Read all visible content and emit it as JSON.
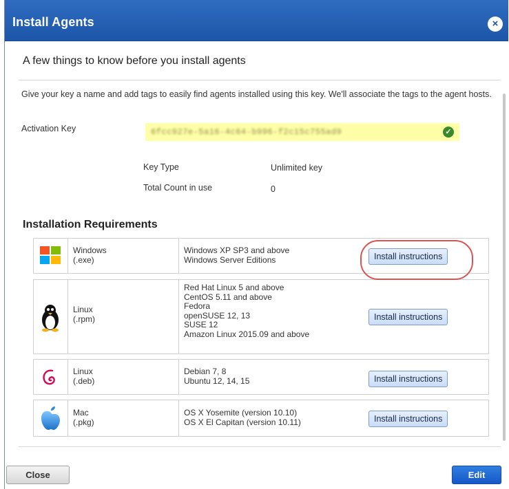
{
  "dialog": {
    "title": "Install Agents",
    "close_icon": "×",
    "subtitle": "A few things to know before you install agents",
    "intro": "Give your key a name and add tags to easily find agents installed using this key. We'll associate the tags to the agent hosts.",
    "activation_key_label": "Activation Key",
    "activation_key_value": "6fcc927e-5a16-4c64-b996-f2c15c755ad9",
    "key_type_label": "Key Type",
    "key_type_value": "Unlimited key",
    "total_count_label": "Total Count in use",
    "total_count_value": "0",
    "requirements_heading": "Installation Requirements",
    "requirements": [
      {
        "icon": "windows-logo",
        "name": "Windows",
        "ext": "(.exe)",
        "versions": "Windows XP SP3 and above\nWindows Server Editions",
        "button": "Install instructions"
      },
      {
        "icon": "linux-tux",
        "name": "Linux",
        "ext": "(.rpm)",
        "versions": "Red Hat Linux 5 and above\nCentOS 5.11 and above\nFedora\nopenSUSE 12, 13\nSUSE 12\nAmazon Linux 2015.09 and above",
        "button": "Install instructions"
      },
      {
        "icon": "debian-swirl",
        "name": "Linux",
        "ext": "(.deb)",
        "versions": "Debian 7, 8\nUbuntu 12, 14, 15",
        "button": "Install instructions"
      },
      {
        "icon": "apple-logo",
        "name": "Mac",
        "ext": "(.pkg)",
        "versions": "OS X Yosemite (version 10.10)\nOS X El Capitan (version 10.11)",
        "button": "Install instructions"
      }
    ],
    "close_button": "Close",
    "edit_button": "Edit"
  },
  "colors": {
    "title_bar": "#1d56a8",
    "key_highlight": "#ffffa8",
    "primary_button": "#1658c8",
    "annotation_ring": "#d9534f"
  }
}
